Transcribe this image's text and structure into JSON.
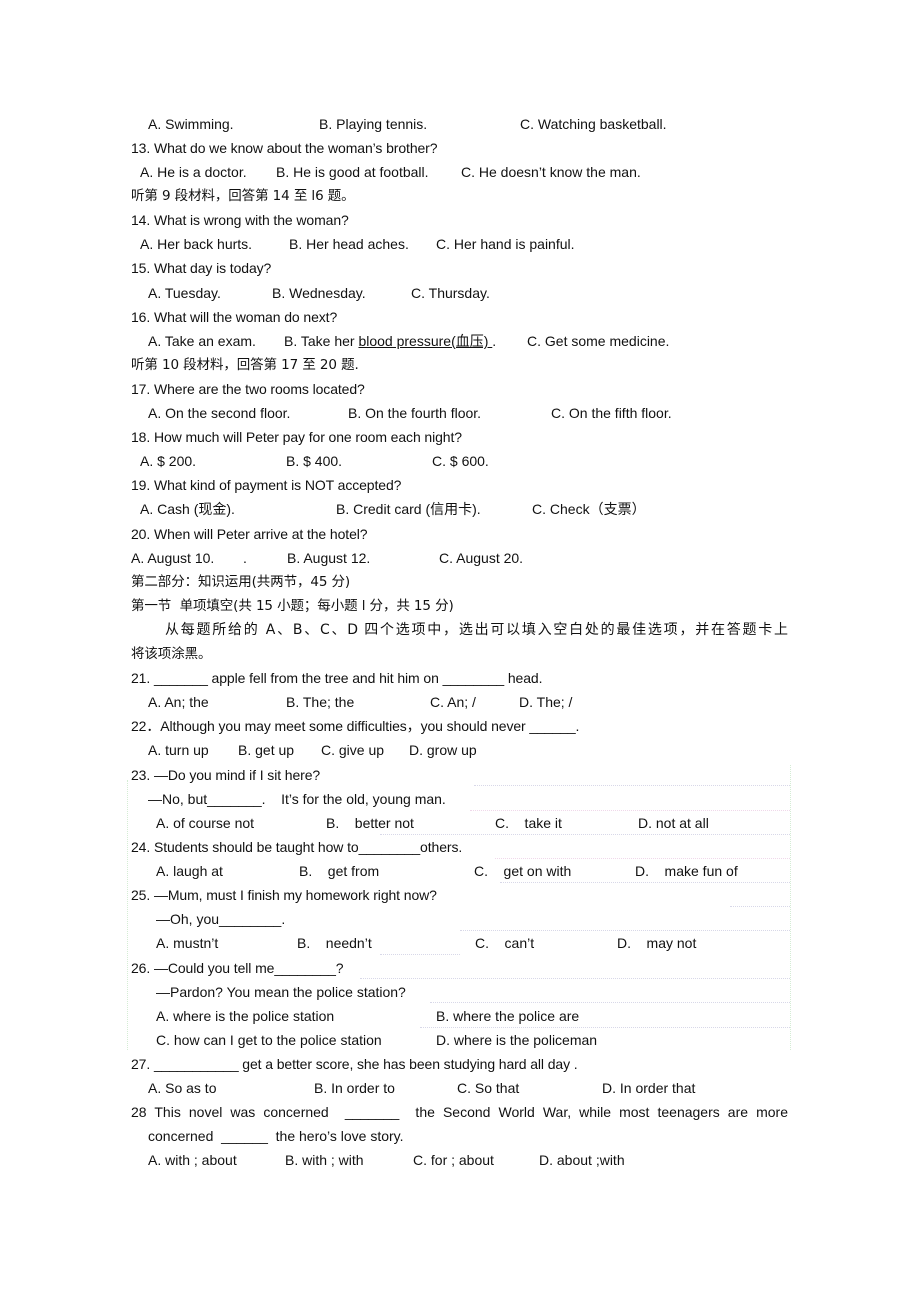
{
  "document": {
    "q12_options": [
      "A. Swimming.",
      "B. Playing tennis.",
      "C. Watching basketball."
    ],
    "q13": {
      "stem": "13. What do we know about the woman’s brother?",
      "options": [
        "A. He is a doctor.",
        "B. He is good at football.",
        "C. He doesn’t know the man."
      ]
    },
    "section9": "听第 9 段材料，回答第 14 至 l6 题。",
    "q14": {
      "stem": "14. What is wrong with the woman?",
      "options": [
        "A. Her back hurts.",
        "B. Her head aches.",
        "C. Her hand is painful."
      ]
    },
    "q15": {
      "stem": "15. What day is today?",
      "options": [
        "A. Tuesday.",
        "B. Wednesday.",
        "C. Thursday."
      ]
    },
    "q16": {
      "stem": "16. What will the woman do next?",
      "options": [
        "A. Take an exam.",
        "B. Take her ",
        "blood pressure(血压) ",
        ".",
        "C. Get some medicine."
      ]
    },
    "section10": "听第 10 段材料，回答第 17 至 20 题.",
    "q17": {
      "stem": "17. Where are the two rooms located?",
      "options": [
        "A. On the second floor.",
        "B. On the fourth floor.",
        "C. On the fifth floor."
      ]
    },
    "q18": {
      "stem": "18. How much will Peter pay for one room each night?",
      "options": [
        "A. $ 200.",
        "B. $ 400.",
        "C. $ 600."
      ]
    },
    "q19": {
      "stem": "19. What kind of payment is NOT accepted?",
      "options": [
        "A. Cash (现金).",
        "B. Credit card (信用卡).",
        "C. Check（支票）"
      ]
    },
    "q20": {
      "stem": "20. When will Peter arrive at the hotel?",
      "options": [
        "A. August 10.",
        ".",
        "B. August 12.",
        "C. August 20."
      ]
    },
    "part2_title": "第二部分：知识运用(共两节，45 分)",
    "section1_title": "第一节  单项填空(共 15 小题；每小题 l 分，共 15 分)",
    "instructions_line1": "从每题所给的 A、B、C、D 四个选项中，选出可以填入空白处的最佳选项，并在答题卡上",
    "instructions_line2": "将该项涂黑。",
    "q21": {
      "stem": "21. _______ apple fell from the tree and hit him on ________ head.",
      "options": [
        "A. An; the",
        "B. The; the",
        "C. An; /",
        "D. The; /"
      ]
    },
    "q22": {
      "stem": "22．Although you may meet some difficulties，you should never ______.",
      "options": [
        "A. turn up",
        "B. get up",
        "C. give up",
        "D. grow up"
      ]
    },
    "q23": {
      "stem": "23. —Do you mind if I sit here?",
      "line2": "—No, but_______.    It’s for the old, young man.",
      "options": [
        "A. of course not",
        "B.    better not",
        "C.    take it",
        "D. not at all"
      ]
    },
    "q24": {
      "stem": "24. Students should be taught how to________others.",
      "options": [
        "A. laugh at",
        "B.    get from",
        "C.    get on with",
        "D.    make fun of"
      ]
    },
    "q25": {
      "stem": "25. —Mum, must I finish my homework right now?",
      "line2": "—Oh, you________.",
      "options": [
        "A. mustn’t",
        "B.    needn’t",
        "C.    can’t",
        "D.    may not"
      ]
    },
    "q26": {
      "stem": "26. —Could you tell me________?",
      "line2": "—Pardon? You mean the police station?",
      "options": [
        "A. where is the police station",
        "B. where the police are",
        "C. how can I get to the police station",
        "D. where is the policeman"
      ]
    },
    "q27": {
      "stem": "27. ___________ get a better score, she has been studying hard all day .",
      "options": [
        "A. So as to",
        "B. In order to",
        "C. So that",
        "D. In order that"
      ]
    },
    "q28": {
      "stem": "28 This novel was concerned  _______  the Second World War, while most teenagers are more",
      "line2": "concerned  ______  the hero’s love story.",
      "options": [
        "A. with ; about",
        "B. with ; with",
        "C. for ; about",
        "D. about ;with"
      ]
    }
  }
}
